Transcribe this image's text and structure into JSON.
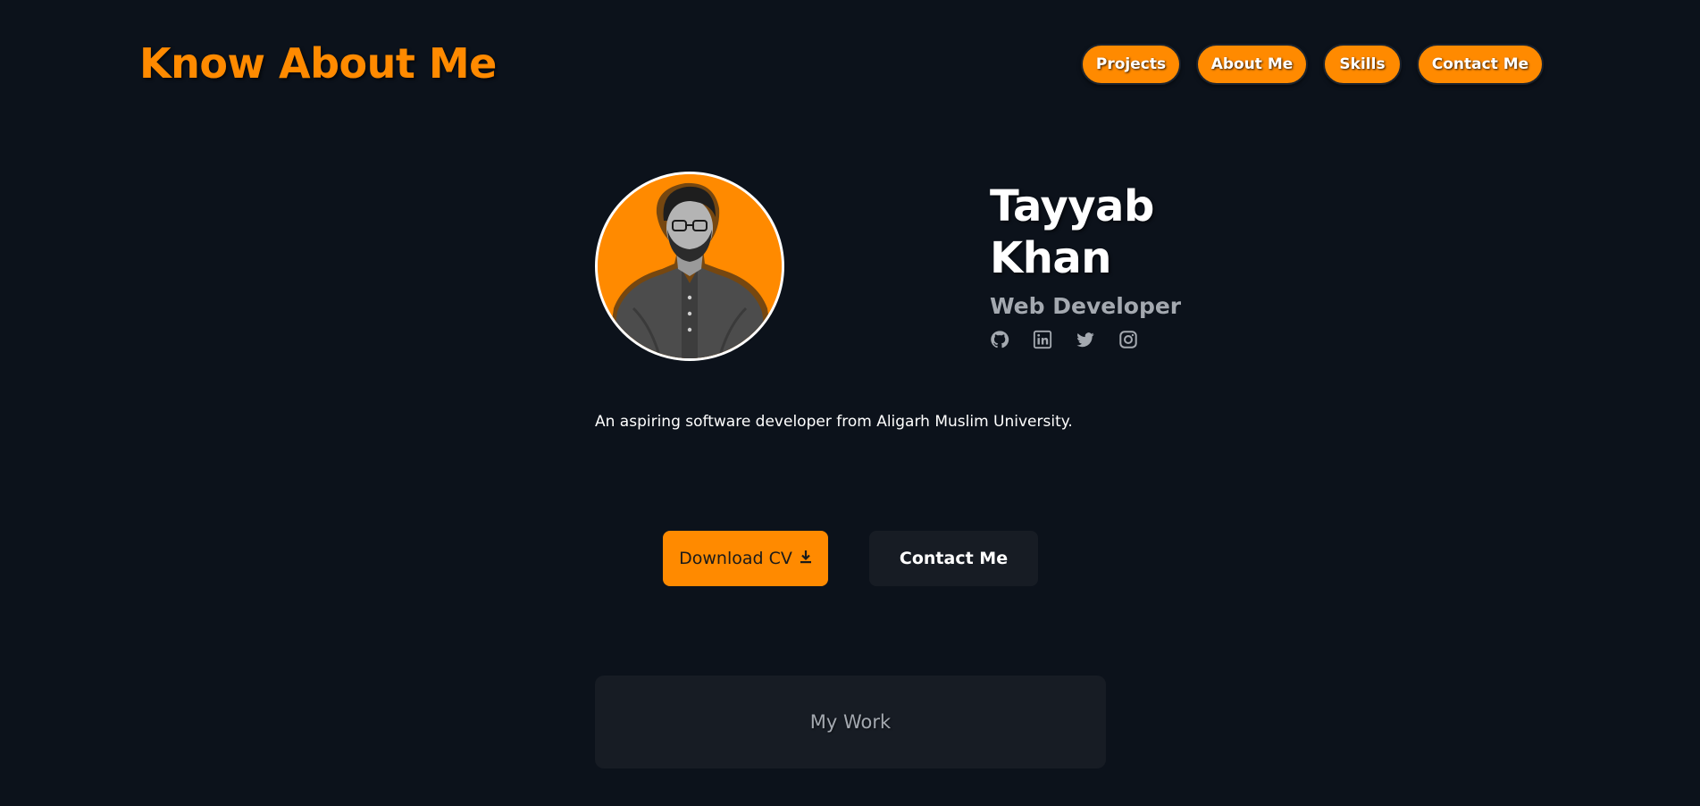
{
  "header": {
    "brand": "Know About Me",
    "nav": [
      "Projects",
      "About Me",
      "Skills",
      "Contact Me"
    ]
  },
  "profile": {
    "name_first": "Tayyab",
    "name_last": "Khan",
    "role": "Web Developer",
    "socials": [
      "github-icon",
      "linkedin-icon",
      "twitter-icon",
      "instagram-icon"
    ],
    "bio": "An aspiring software developer from Aligarh Muslim University."
  },
  "actions": {
    "download_cv": "Download CV",
    "contact": "Contact Me"
  },
  "work": {
    "label": "My Work"
  },
  "colors": {
    "background": "#0c121b",
    "accent": "#ff8a00",
    "card": "#171c24",
    "muted_text": "#a4a9b0"
  }
}
